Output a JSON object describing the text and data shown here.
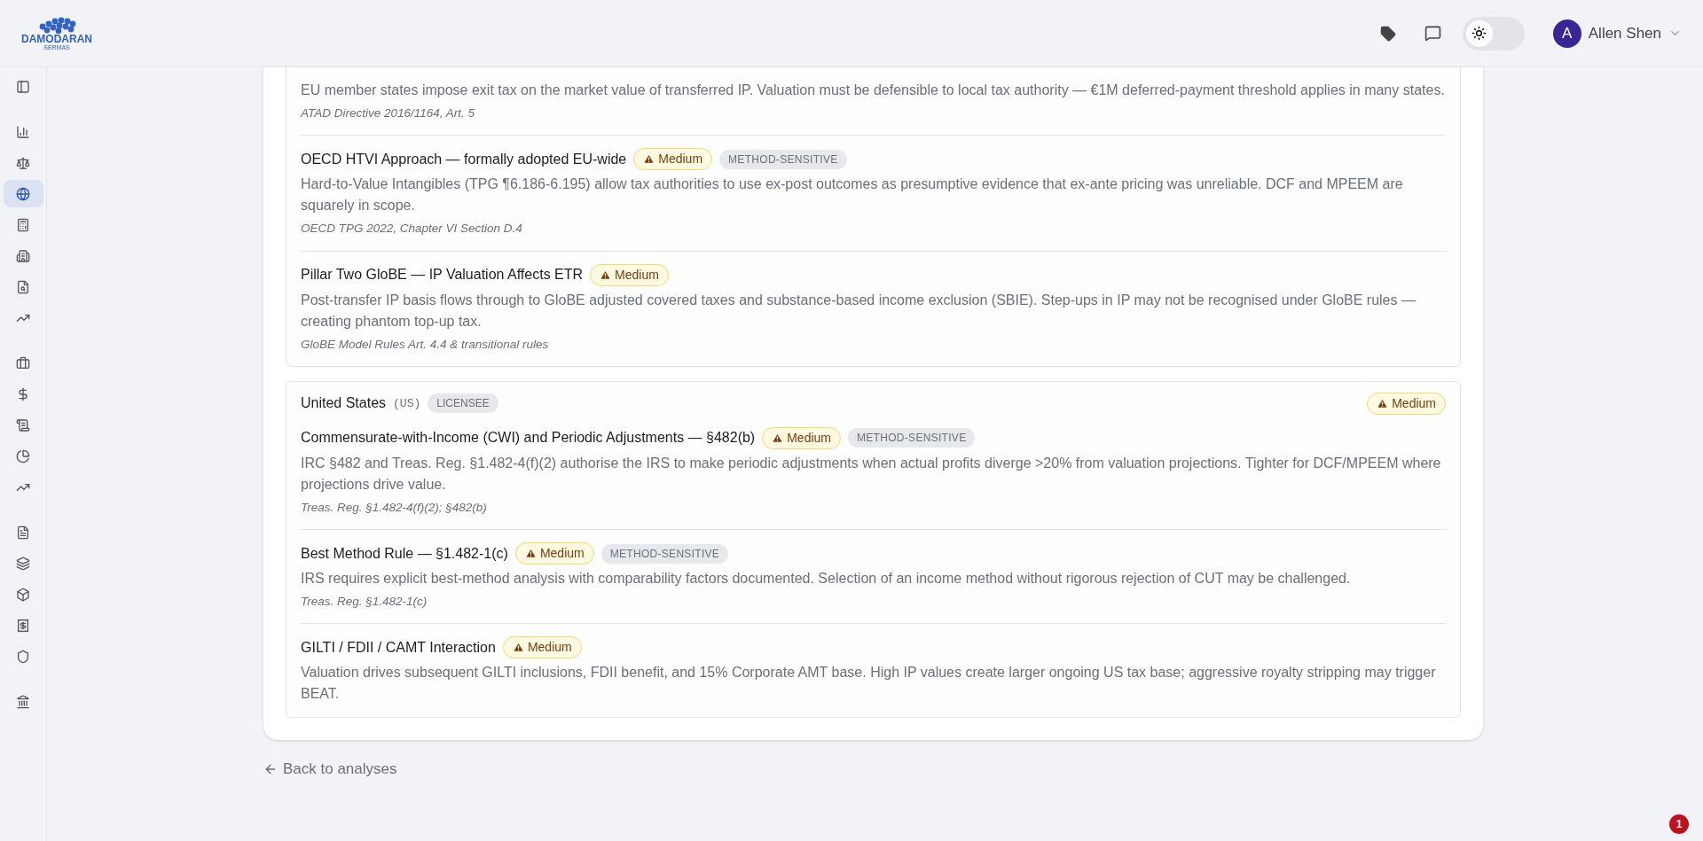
{
  "header": {
    "logo_text": "DAMODARAN",
    "logo_subtext": "SERMAS",
    "theme_toggle": {
      "on": false
    },
    "user": {
      "initial": "A",
      "name": "Allen Shen"
    }
  },
  "sidebar": {
    "items": [
      {
        "selected": false
      },
      {
        "selected": false
      },
      {
        "selected": false
      },
      {
        "selected": true
      },
      {
        "selected": false
      },
      {
        "selected": false
      },
      {
        "selected": false
      },
      {
        "selected": false
      },
      {
        "selected": false
      },
      {
        "selected": false
      },
      {
        "selected": false
      },
      {
        "selected": false
      },
      {
        "selected": false
      },
      {
        "selected": false
      },
      {
        "selected": false
      },
      {
        "selected": false
      },
      {
        "selected": false
      },
      {
        "selected": false
      },
      {
        "selected": false
      }
    ]
  },
  "jurisdictions": [
    {
      "continued": true,
      "risks": [
        {
          "body": "EU member states impose exit tax on the market value of transferred IP. Valuation must be defensible to local tax authority — €1M deferred-payment threshold applies in many states.",
          "citation": "ATAD Directive 2016/1164, Art. 5"
        },
        {
          "title": "OECD HTVI Approach — formally adopted EU-wide",
          "severity": "Medium",
          "tag": "METHOD-SENSITIVE",
          "body": "Hard-to-Value Intangibles (TPG ¶6.186-6.195) allow tax authorities to use ex-post outcomes as presumptive evidence that ex-ante pricing was unreliable. DCF and MPEEM are squarely in scope.",
          "citation": "OECD TPG 2022, Chapter VI Section D.4"
        },
        {
          "title": "Pillar Two GloBE — IP Valuation Affects ETR",
          "severity": "Medium",
          "body": "Post-transfer IP basis flows through to GloBE adjusted covered taxes and substance-based income exclusion (SBIE). Step-ups in IP may not be recognised under GloBE rules — creating phantom top-up tax.",
          "citation": "GloBE Model Rules Art. 4.4 & transitional rules"
        }
      ]
    },
    {
      "continued": false,
      "name": "United States",
      "code": "(US)",
      "role": "LICENSEE",
      "severity": "Medium",
      "risks": [
        {
          "title": "Commensurate-with-Income (CWI) and Periodic Adjustments — §482(b)",
          "severity": "Medium",
          "tag": "METHOD-SENSITIVE",
          "body": "IRC §482 and Treas. Reg. §1.482-4(f)(2) authorise the IRS to make periodic adjustments when actual profits diverge >20% from valuation projections. Tighter for DCF/MPEEM where projections drive value.",
          "citation": "Treas. Reg. §1.482-4(f)(2); §482(b)"
        },
        {
          "title": "Best Method Rule — §1.482-1(c)",
          "severity": "Medium",
          "tag": "METHOD-SENSITIVE",
          "body": "IRS requires explicit best-method analysis with comparability factors documented. Selection of an income method without rigorous rejection of CUT may be challenged.",
          "citation": "Treas. Reg. §1.482-1(c)"
        },
        {
          "title": "GILTI / FDII / CAMT Interaction",
          "severity": "Medium",
          "body": "Valuation drives subsequent GILTI inclusions, FDII benefit, and 15% Corporate AMT base. High IP values create larger ongoing US tax base; aggressive royalty stripping may trigger BEAT."
        }
      ]
    }
  ],
  "back_link": "Back to analyses",
  "notification_count": "1"
}
